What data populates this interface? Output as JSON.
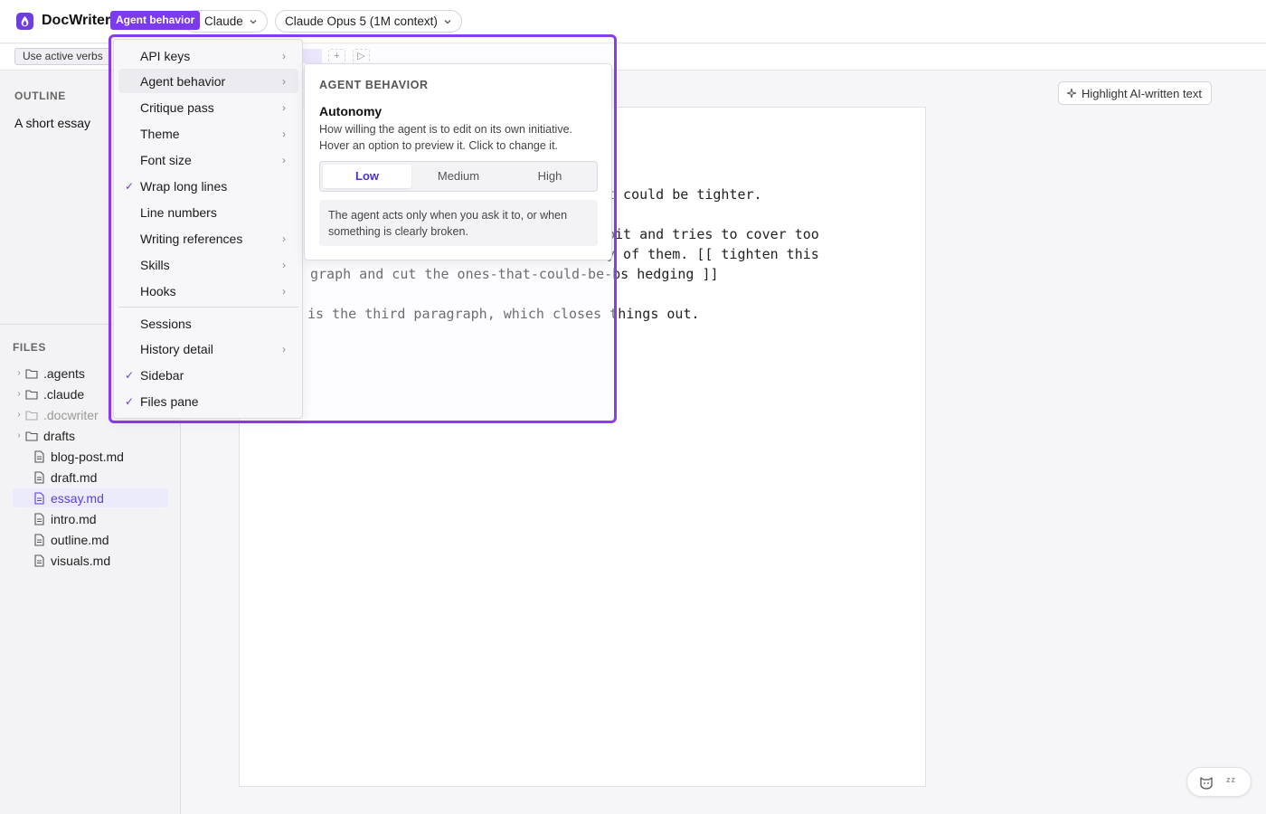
{
  "app": {
    "title": "DocWriter",
    "provider": "Claude",
    "model": "Claude Opus 5 (1M context)"
  },
  "toolbar": {
    "chip": "Use active verbs",
    "add_label": "+",
    "run_label": "▷"
  },
  "outline": {
    "heading": "OUTLINE",
    "items": [
      "A short essay"
    ]
  },
  "files": {
    "heading": "FILES",
    "items": [
      {
        "name": ".agents",
        "type": "folder"
      },
      {
        "name": ".claude",
        "type": "folder"
      },
      {
        "name": ".docwriter",
        "type": "folder",
        "dim": true
      },
      {
        "name": "drafts",
        "type": "folder"
      },
      {
        "name": "blog-post.md",
        "type": "file"
      },
      {
        "name": "draft.md",
        "type": "file"
      },
      {
        "name": "essay.md",
        "type": "file",
        "active": true
      },
      {
        "name": "intro.md",
        "type": "file"
      },
      {
        "name": "outline.md",
        "type": "file"
      },
      {
        "name": "visuals.md",
        "type": "file"
      }
    ]
  },
  "editor": {
    "lines": [
      "t could be tighter.",
      "bit and tries to cover too",
      "y of them. [[ tighten this",
      "graph and cut the ones-that-could-be-bs hedging ]]",
      " is the third paragraph, which closes things out."
    ],
    "highlight_button": "Highlight AI-written text"
  },
  "focus": {
    "label": "Agent behavior"
  },
  "menu": {
    "items": [
      {
        "label": "API keys",
        "submenu": true
      },
      {
        "label": "Agent behavior",
        "submenu": true,
        "active": true
      },
      {
        "label": "Critique pass",
        "submenu": true
      },
      {
        "label": "Theme",
        "submenu": true
      },
      {
        "label": "Font size",
        "submenu": true
      },
      {
        "label": "Wrap long lines",
        "checked": true
      },
      {
        "label": "Line numbers"
      },
      {
        "label": "Writing references",
        "submenu": true
      },
      {
        "label": "Skills",
        "submenu": true
      },
      {
        "label": "Hooks",
        "submenu": true
      },
      {
        "label": "Sessions"
      },
      {
        "label": "History detail",
        "submenu": true
      },
      {
        "label": "Sidebar",
        "checked": true
      },
      {
        "label": "Files pane",
        "checked": true
      }
    ]
  },
  "submenu": {
    "heading": "AGENT BEHAVIOR",
    "title": "Autonomy",
    "description": "How willing the agent is to edit on its own initiative. Hover an option to preview it. Click to change it.",
    "options": [
      "Low",
      "Medium",
      "High"
    ],
    "selected": "Low",
    "note": "The agent acts only when you ask it to, or when something is clearly broken."
  },
  "status": {
    "sleep_label": "zz"
  },
  "colors": {
    "accent": "#7c3aed",
    "selected_text": "#4b32c8"
  }
}
